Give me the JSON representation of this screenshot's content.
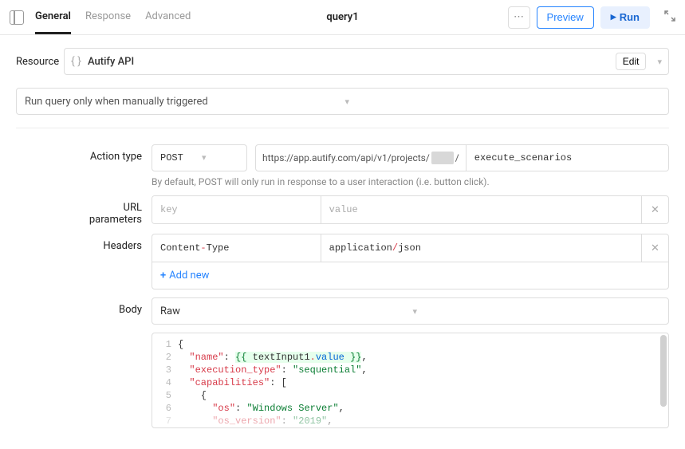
{
  "tabs": {
    "general": "General",
    "response": "Response",
    "advanced": "Advanced"
  },
  "queryName": "query1",
  "ellipsis": "⋯",
  "buttons": {
    "preview": "Preview",
    "run": "Run"
  },
  "resource": {
    "label": "Resource",
    "name": "Autify API",
    "edit": "Edit"
  },
  "trigger": "Run query only when manually triggered",
  "action": {
    "label": "Action type",
    "method": "POST",
    "urlPrefix": "https://app.autify.com/api/v1/projects/",
    "urlSlash": "/",
    "urlValue": "execute_scenarios",
    "hint": "By default, POST will only run in response to a user interaction (i.e. button click)."
  },
  "urlParams": {
    "label": "URL parameters",
    "keyPlaceholder": "key",
    "valuePlaceholder": "value"
  },
  "headers": {
    "label": "Headers",
    "key": "Content-Type",
    "valuePart1": "application",
    "valuePart2": "/",
    "valuePart3": "json",
    "addNew": "Add new"
  },
  "body": {
    "label": "Body",
    "type": "Raw",
    "lines": {
      "l1": "{",
      "l2_k": "\"name\"",
      "l2_c": ": ",
      "l2_mo": "{{ ",
      "l2_v1": "textInput1",
      "l2_d": ".",
      "l2_v2": "value",
      "l2_mc": " }}",
      "l2_e": ",",
      "l3_k": "\"execution_type\"",
      "l3_c": ": ",
      "l3_v": "\"sequential\"",
      "l3_e": ",",
      "l4_k": "\"capabilities\"",
      "l4_c": ": [",
      "l5": "    {",
      "l6_k": "\"os\"",
      "l6_c": ": ",
      "l6_v": "\"Windows Server\"",
      "l6_e": ",",
      "l7_k": "\"os_version\"",
      "l7_c": ": ",
      "l7_v": "\"2019\"",
      "l7_e": ","
    },
    "gutter": {
      "n1": "1",
      "n2": "2",
      "n3": "3",
      "n4": "4",
      "n5": "5",
      "n6": "6",
      "n7": "7"
    }
  }
}
